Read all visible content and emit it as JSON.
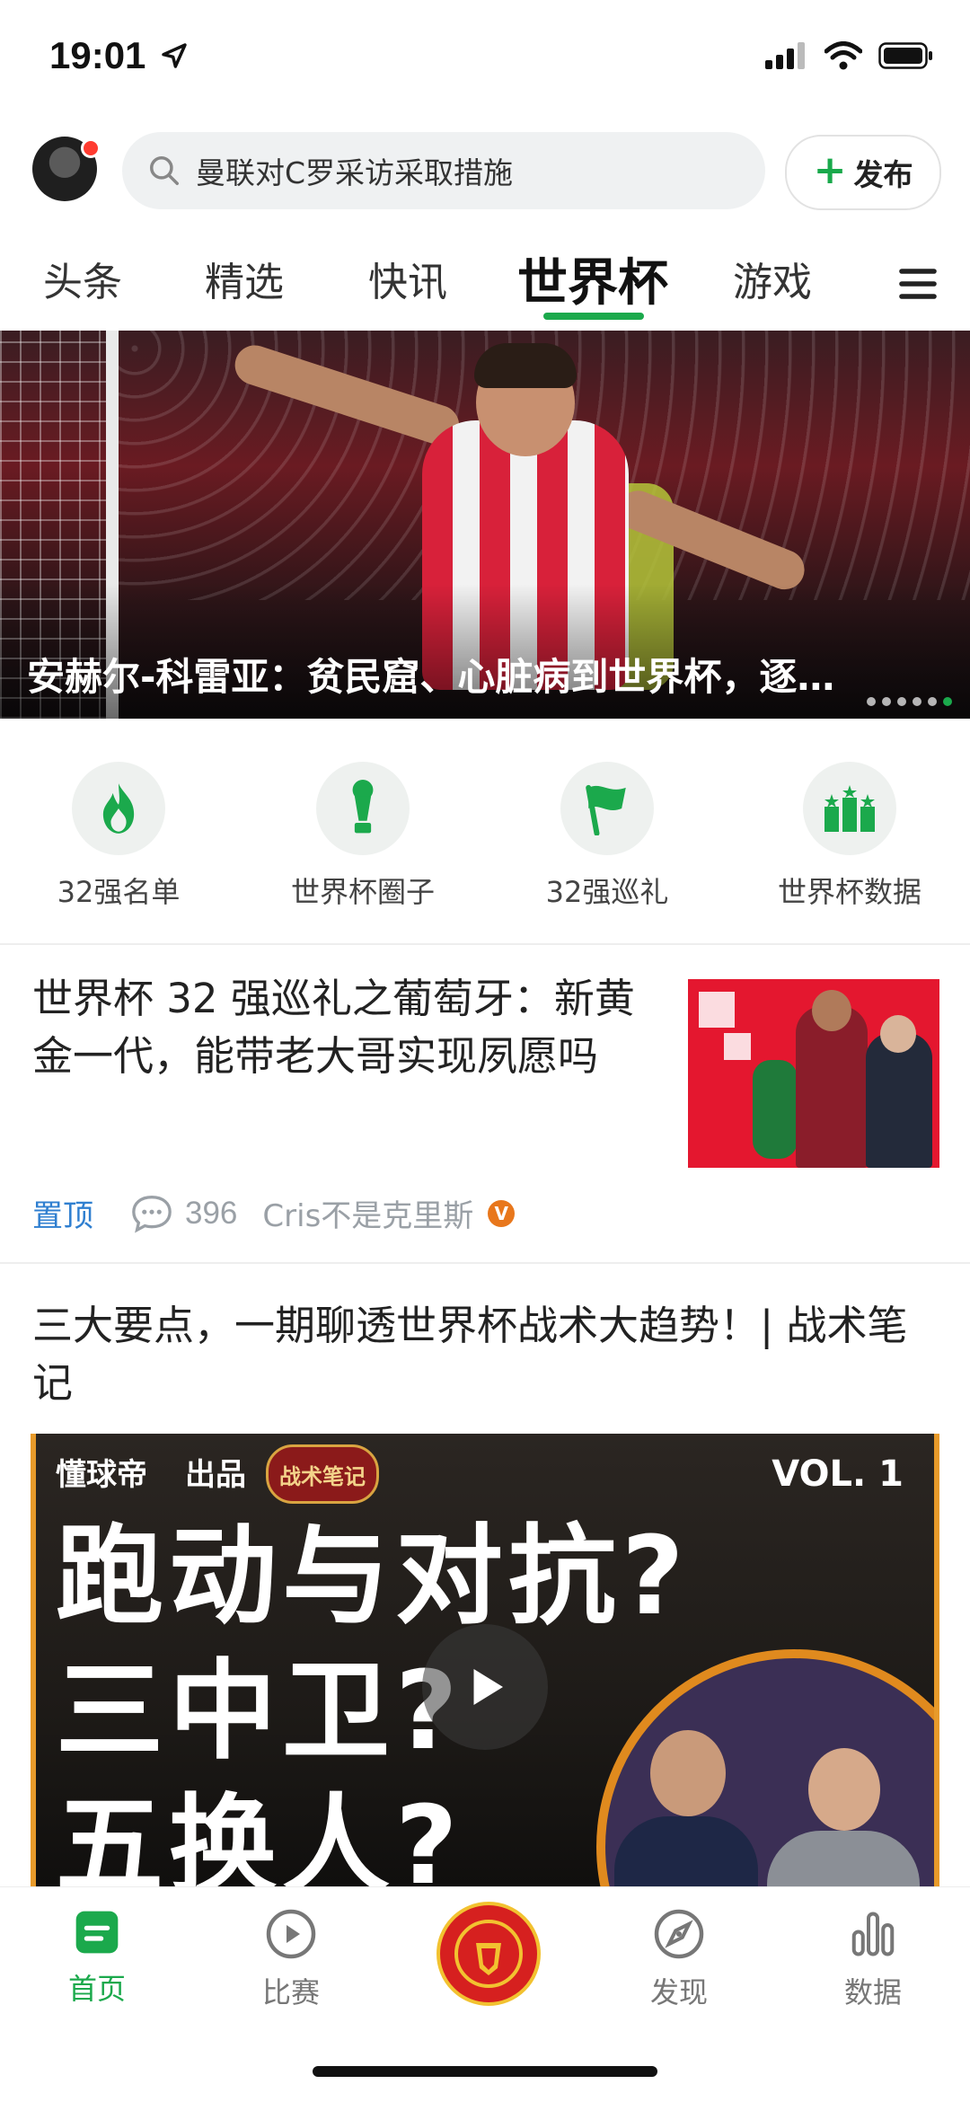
{
  "status_bar": {
    "time": "19:01"
  },
  "search": {
    "placeholder": "曼联对C罗采访采取措施",
    "publish_label": "发布"
  },
  "tabs": [
    "头条",
    "精选",
    "快讯",
    "世界杯",
    "游戏"
  ],
  "active_tab": "世界杯",
  "hero": {
    "title": "安赫尔-科雷亚：贫民窟、心脏病到世界杯，逐…",
    "slide_count": 6,
    "active_slide": 6
  },
  "shortcuts": [
    {
      "label": "32强名单",
      "icon": "flame-icon"
    },
    {
      "label": "世界杯圈子",
      "icon": "trophy-icon"
    },
    {
      "label": "32强巡礼",
      "icon": "flag-icon"
    },
    {
      "label": "世界杯数据",
      "icon": "podium-icon"
    }
  ],
  "articles": [
    {
      "title": "世界杯 32 强巡礼之葡萄牙：新黄金一代，能带老大哥实现夙愿吗",
      "tag": "置顶",
      "comments": "396",
      "author": "Cris不是克里斯",
      "verified_badge": "V"
    },
    {
      "title": "三大要点，一期聊透世界杯战术大趋势！| 战术笔记",
      "video": {
        "brand1": "懂球帝",
        "brand2": "出品",
        "brand3": "战术笔记",
        "vol": "VOL. 1",
        "line1": "跑动与对抗?",
        "line2": "三中卫?",
        "line3": "五换人?"
      }
    }
  ],
  "bottom_nav": [
    {
      "label": "首页",
      "icon": "home-icon",
      "active": true
    },
    {
      "label": "比赛",
      "icon": "play-circle-icon",
      "active": false
    },
    {
      "label": "",
      "icon": "team-logo-icon",
      "active": false
    },
    {
      "label": "发现",
      "icon": "compass-icon",
      "active": false
    },
    {
      "label": "数据",
      "icon": "bar-chart-icon",
      "active": false
    }
  ],
  "colors": {
    "accent": "#1ba94c",
    "pinned": "#2f7fd0",
    "badge": "#e8771c"
  }
}
